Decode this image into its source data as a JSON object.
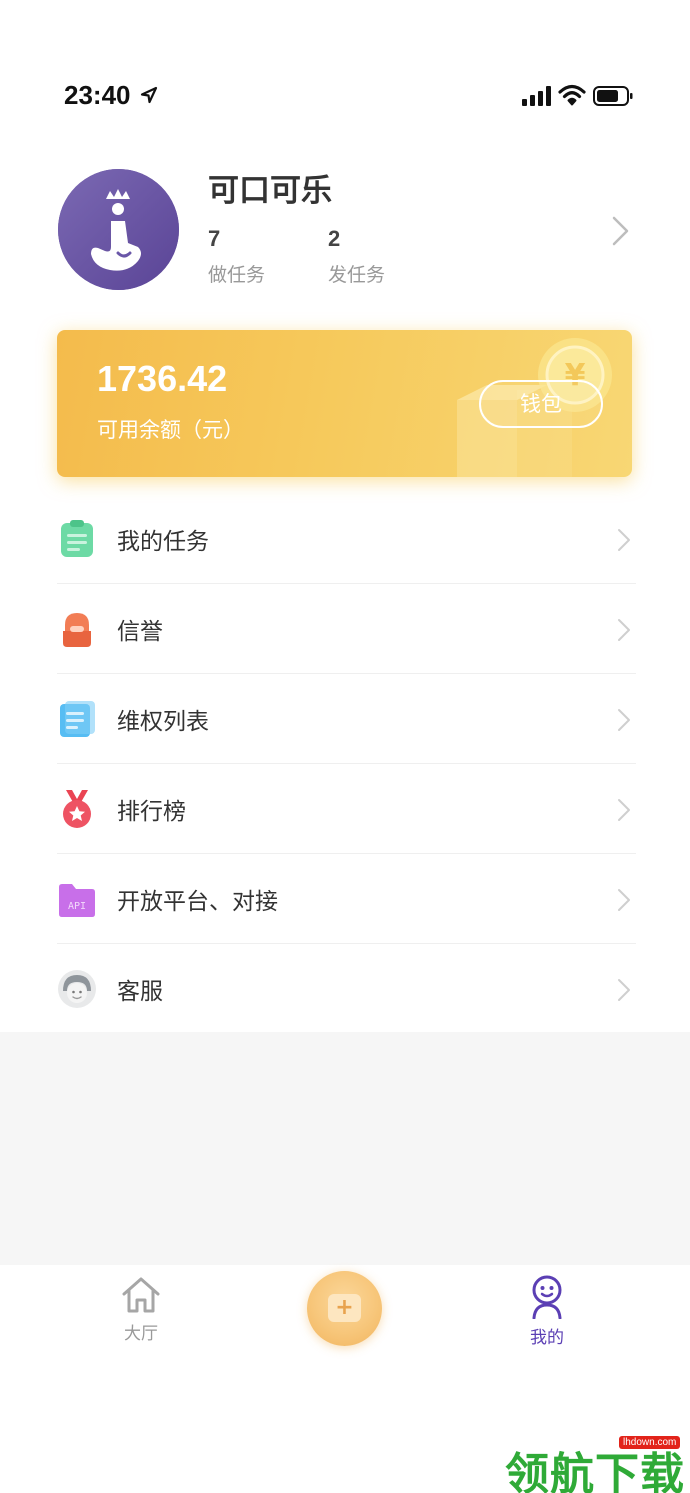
{
  "status_bar": {
    "time": "23:40"
  },
  "profile": {
    "name": "可口可乐",
    "stats": [
      {
        "value": "7",
        "label": "做任务"
      },
      {
        "value": "2",
        "label": "发任务"
      }
    ]
  },
  "balance": {
    "amount": "1736.42",
    "label": "可用余额（元）",
    "wallet_label": "钱包"
  },
  "menu": {
    "items": [
      {
        "label": "我的任务",
        "icon": "clipboard-icon",
        "color": "#5fd39a"
      },
      {
        "label": "信誉",
        "icon": "backpack-icon",
        "color": "#f07a52"
      },
      {
        "label": "维权列表",
        "icon": "document-icon",
        "color": "#4fb8f2"
      },
      {
        "label": "排行榜",
        "icon": "medal-icon",
        "color": "#ee4b5a"
      },
      {
        "label": "开放平台、对接",
        "icon": "api-folder-icon",
        "color": "#c66ee8"
      },
      {
        "label": "客服",
        "icon": "customer-service-icon",
        "color": "#9aa0a6"
      }
    ]
  },
  "tabbar": {
    "home_label": "大厅",
    "mine_label": "我的",
    "active_color": "#5b3fb4"
  },
  "watermark": {
    "text": "领航下载",
    "url": "lhdown.com"
  }
}
